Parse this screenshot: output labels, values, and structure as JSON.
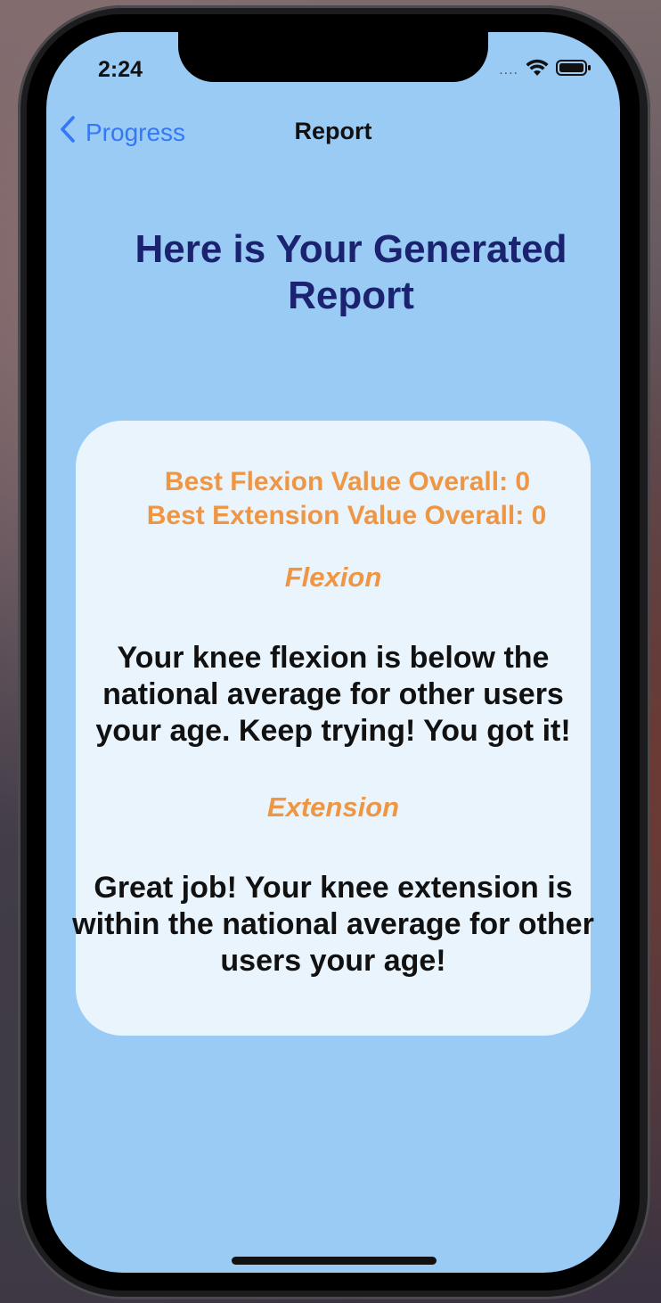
{
  "status_bar": {
    "time": "2:24",
    "signal_dots": "....",
    "icons": [
      "wifi-icon",
      "battery-icon"
    ]
  },
  "nav": {
    "back_label": "Progress",
    "title": "Report"
  },
  "heading": "Here is Your Generated Report",
  "report": {
    "best_flexion": "Best Flexion Value Overall: 0",
    "best_extension": "Best Extension Value Overall: 0",
    "flexion_title": "Flexion",
    "flexion_message": "Your knee flexion is below the national average for other users your age. Keep trying! You got it!",
    "extension_title": "Extension",
    "extension_message": "Great job! Your knee extension is within the national average for other users your age!"
  },
  "colors": {
    "background": "#99cbf4",
    "heading": "#1b2270",
    "accent_orange": "#ef9645",
    "link_blue": "#3478f6",
    "card": "#eaf4fc"
  }
}
